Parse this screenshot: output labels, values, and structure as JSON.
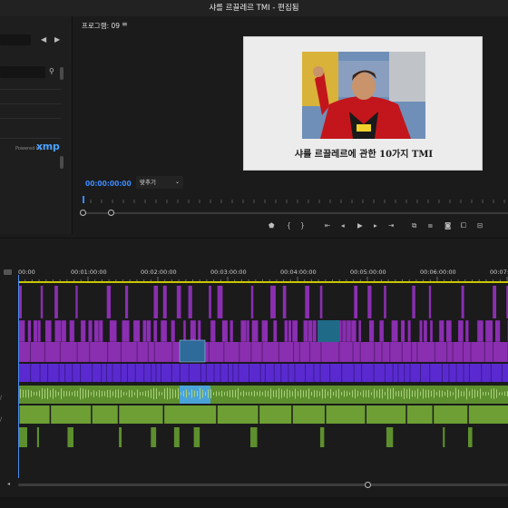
{
  "window": {
    "title": "샤를 르끌레르 TMI - 편집됨"
  },
  "program_monitor": {
    "panel_title": "프로그램: 09",
    "menu_icon": "hamburger-icon",
    "caption": "샤를 르끌레르에 관한 10가지 TMI",
    "timecode": "00:00:00:00",
    "fit_label": "맞추기"
  },
  "metadata_panel": {
    "powered_by": "Powered by",
    "xmp_logo": "xmp"
  },
  "timeline": {
    "ruler": [
      "00:00",
      "00:01:00:00",
      "00:02:00:00",
      "00:03:00:00",
      "00:04:00:00",
      "00:05:00:00",
      "00:06:00:00",
      "00:07:0"
    ]
  },
  "transport_icons": [
    "marker-icon",
    "in-point-icon",
    "out-point-icon",
    "go-to-in-icon",
    "step-back-icon",
    "play-icon",
    "step-forward-icon",
    "go-to-out-icon",
    "insert-icon",
    "overwrite-icon",
    "camera-icon",
    "compare-icon",
    "settings-icon"
  ],
  "colors": {
    "accent_blue": "#3d8bff",
    "video_purple": "#8a2fb0",
    "video_violet": "#5a2ad0",
    "audio_green": "#5d8f2e",
    "work_area_yellow": "#c9c700"
  }
}
